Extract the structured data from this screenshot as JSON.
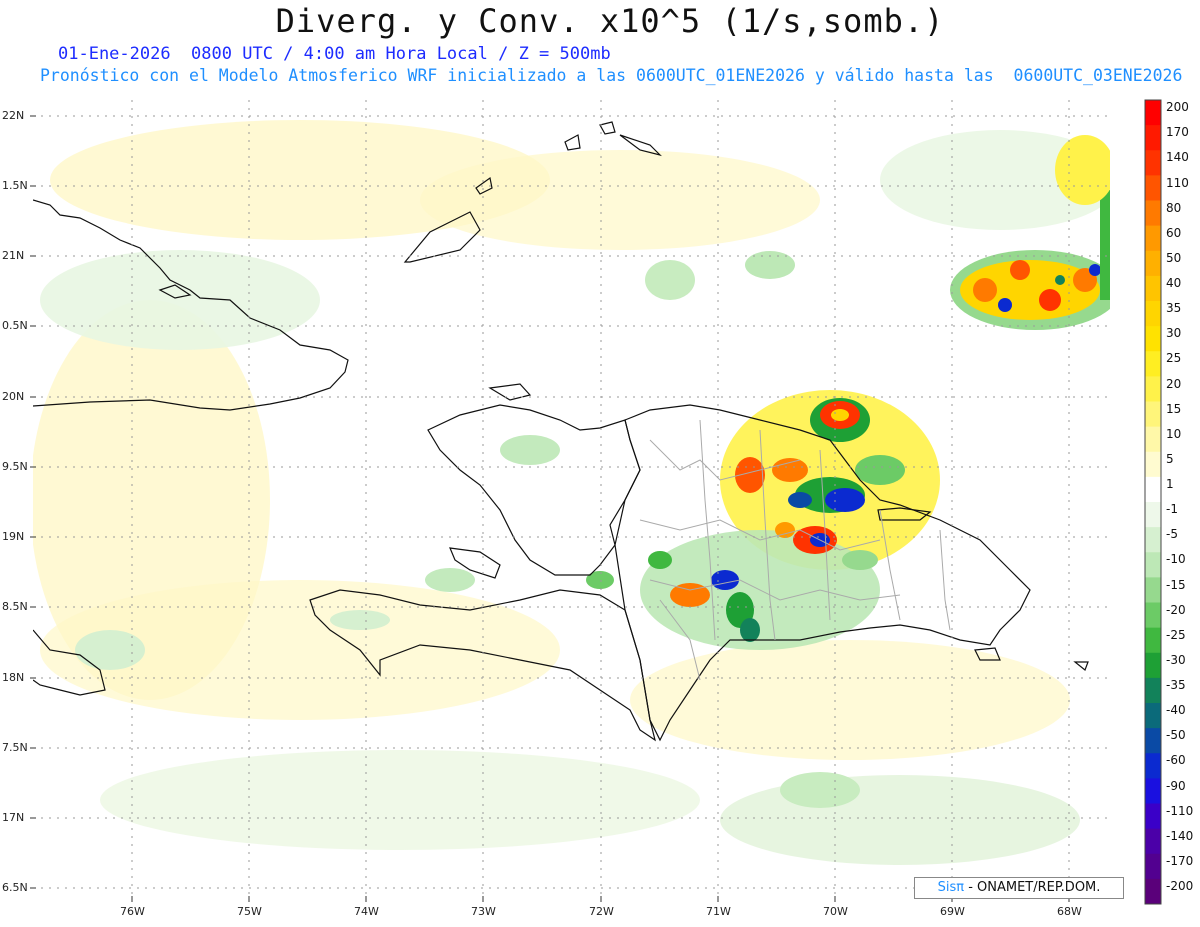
{
  "title": "Diverg. y Conv. x10^5 (1/s,somb.)",
  "subtitle_line1": "01-Ene-2026  0800 UTC / 4:00 am Hora Local / Z = 500mb",
  "subtitle_line2": "Pronóstico con el Modelo Atmosferico WRF inicializado a las 0600UTC_01ENE2026 y válido hasta las  0600UTC_03ENE2026",
  "credit": {
    "brand": "Sisπ",
    "text": "- ONAMET/REP.DOM."
  },
  "latitude_labels": [
    "22N",
    "1.5N",
    "21N",
    "0.5N",
    "20N",
    "9.5N",
    "19N",
    "8.5N",
    "18N",
    "7.5N",
    "17N",
    "6.5N"
  ],
  "longitude_labels": [
    "76W",
    "75W",
    "74W",
    "73W",
    "72W",
    "71W",
    "70W",
    "69W",
    "68W"
  ],
  "colorbar": {
    "labels": [
      "200",
      "170",
      "140",
      "110",
      "80",
      "60",
      "50",
      "40",
      "35",
      "30",
      "25",
      "20",
      "15",
      "10",
      "5",
      "1",
      "-1",
      "-5",
      "-10",
      "-15",
      "-20",
      "-25",
      "-30",
      "-35",
      "-40",
      "-50",
      "-60",
      "-90",
      "-110",
      "-140",
      "-170",
      "-200"
    ],
    "colors": [
      "#ff0000",
      "#ff1a00",
      "#ff3300",
      "#ff5500",
      "#ff7a00",
      "#ff9900",
      "#ffb000",
      "#ffc400",
      "#ffd500",
      "#ffe200",
      "#ffee22",
      "#fff24a",
      "#fff57a",
      "#fff8a8",
      "#fffbd0",
      "#ffffff",
      "#eef8ea",
      "#d6f0d0",
      "#bde8b6",
      "#96d98e",
      "#6ccb66",
      "#40b840",
      "#1ea035",
      "#12825a",
      "#0b6a7a",
      "#0a4aa5",
      "#0b2ad0",
      "#1a10e0",
      "#3a00c8",
      "#4b00a8",
      "#520090",
      "#5a007a"
    ]
  }
}
